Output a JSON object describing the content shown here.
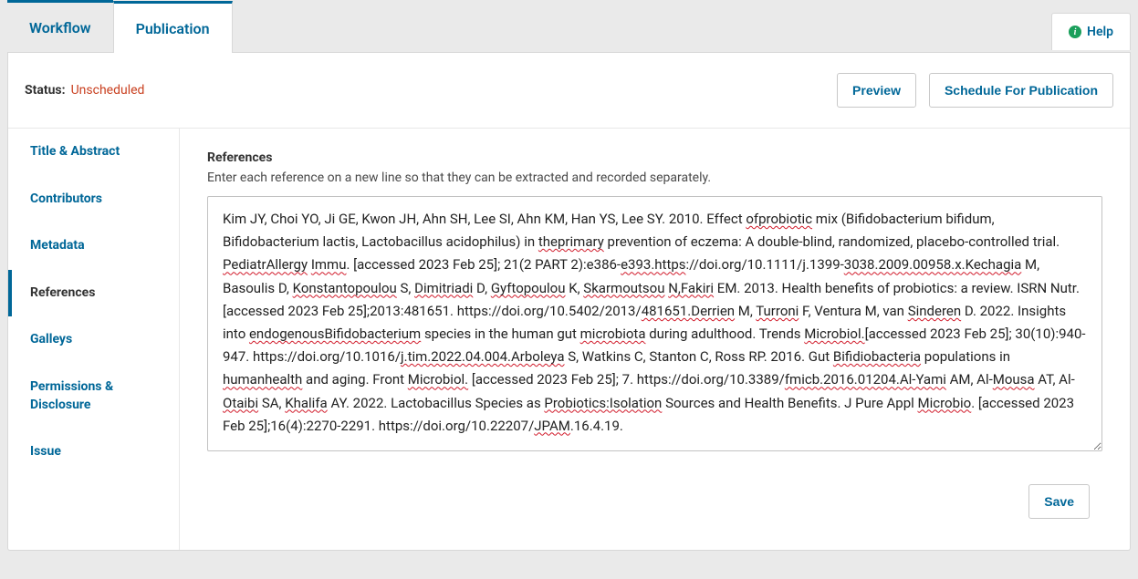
{
  "tabs": {
    "workflow": "Workflow",
    "publication": "Publication"
  },
  "help": {
    "label": "Help"
  },
  "status": {
    "label": "Status:",
    "value": "Unscheduled"
  },
  "actions": {
    "preview": "Preview",
    "schedule": "Schedule For Publication",
    "save": "Save"
  },
  "sidebar": {
    "items": [
      "Title & Abstract",
      "Contributors",
      "Metadata",
      "References",
      "Galleys",
      "Permissions & Disclosure",
      "Issue"
    ],
    "activeIndex": 3
  },
  "references": {
    "title": "References",
    "subtitle": "Enter each reference on a new line so that they can be extracted and recorded separately.",
    "text_plain": "Kim JY, Choi YO, Ji GE, Kwon JH, Ahn SH, Lee SI, Ahn KM, Han YS, Lee SY. 2010. Effect ofprobiotic mix (Bifidobacterium bifidum, Bifidobacterium lactis, Lactobacillus acidophilus) in theprimary prevention of eczema: A double-blind, randomized, placebo-controlled trial. PediatrAllergy Immu. [accessed 2023 Feb 25]; 21(2 PART 2):e386-e393.https://doi.org/10.1111/j.1399-3038.2009.00958.x.Kechagia M, Basoulis D, Konstantopoulou S, Dimitriadi D, Gyftopoulou K, Skarmoutsou N,Fakiri EM. 2013. Health benefits of probiotics: a review. ISRN Nutr. [accessed 2023 Feb 25];2013:481651. https://doi.org/10.5402/2013/481651.Derrien M, Turroni F, Ventura M, van Sinderen D. 2022. Insights into endogenousBifidobacterium species in the human gut microbiota during adulthood. Trends Microbiol.[accessed 2023 Feb 25]; 30(10):940-947. https://doi.org/10.1016/j.tim.2022.04.004.Arboleya S, Watkins C, Stanton C, Ross RP. 2016. Gut Bifidiobacteria populations in humanhealth and aging. Front Microbiol. [accessed 2023 Feb 25]; 7. https://doi.org/10.3389/fmicb.2016.01204.Al-Yami AM, Al-Mousa AT, Al-Otaibi SA, Khalifa AY. 2022. Lactobacillus Species as Probiotics:Isolation Sources and Health Benefits. J Pure Appl Microbio. [accessed 2023 Feb 25];16(4):2270-2291. https://doi.org/10.22207/JPAM.16.4.19.",
    "spellcheck_words": [
      "ofprobiotic",
      "theprimary",
      "PediatrAllergy",
      "Immu",
      "e393.https",
      "3038.2009.00958.x.Kechagia",
      "Konstantopoulou",
      "Dimitriadi",
      "Gyftopoulou",
      "Skarmoutsou",
      "N,Fakiri",
      "481651.Derrien",
      "Turroni",
      "Sinderen",
      "endogenousBifidobacterium",
      "microbiota",
      "Microbiol.",
      "j.tim.2022.04.004.Arboleya",
      "Bifidiobacteria",
      "humanhealth",
      "Microbiol",
      "fmicb.2016.01204.Al-Yami",
      "Mousa",
      "Otaibi",
      "Khalifa",
      "Probiotics:Isolation",
      "Microbio",
      "JPAM"
    ]
  }
}
